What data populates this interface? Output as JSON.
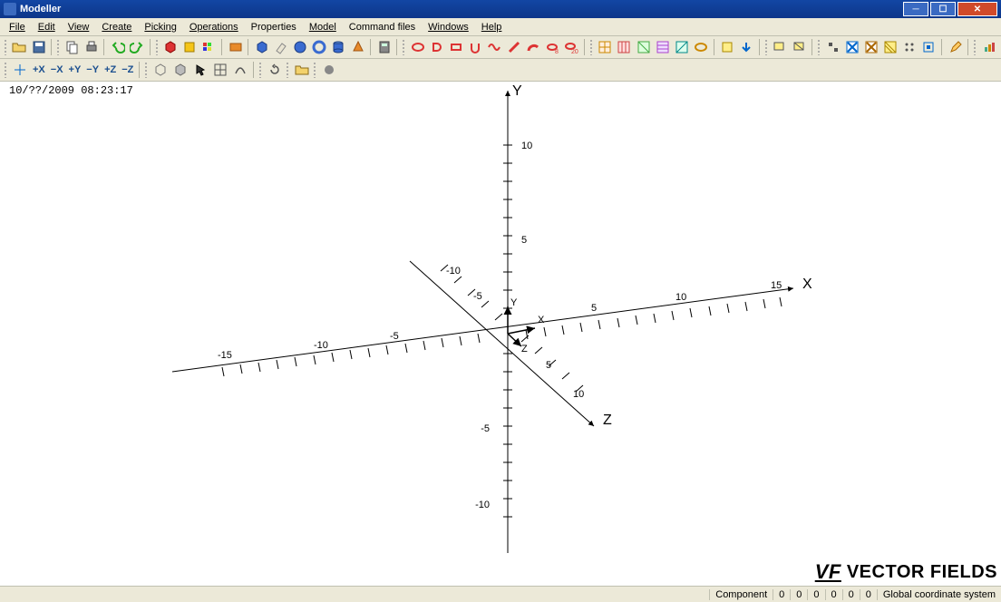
{
  "window": {
    "title": "Modeller"
  },
  "menu": {
    "file": "File",
    "edit": "Edit",
    "view": "View",
    "create": "Create",
    "picking": "Picking",
    "operations": "Operations",
    "properties": "Properties",
    "model": "Model",
    "command_files": "Command files",
    "windows": "Windows",
    "help": "Help"
  },
  "toolbar2": {
    "px": "+X",
    "nx": "−X",
    "py": "+Y",
    "ny": "−Y",
    "pz": "+Z",
    "nz": "−Z"
  },
  "viewport": {
    "timestamp": "10/??/2009 08:23:17",
    "axes": {
      "x": "X",
      "y": "Y",
      "z": "Z",
      "x2": "X",
      "y2": "Y",
      "z2": "Z"
    },
    "ticks": {
      "n15": "-15",
      "n10": "-10",
      "n5": "-5",
      "p5": "5",
      "p10": "10",
      "p15": "15"
    }
  },
  "brand": {
    "logo": "VF",
    "name": "VECTOR FIELDS"
  },
  "status": {
    "component": "Component",
    "c0": "0",
    "c1": "0",
    "c2": "0",
    "c3": "0",
    "c4": "0",
    "c5": "0",
    "coord": "Global coordinate system"
  }
}
